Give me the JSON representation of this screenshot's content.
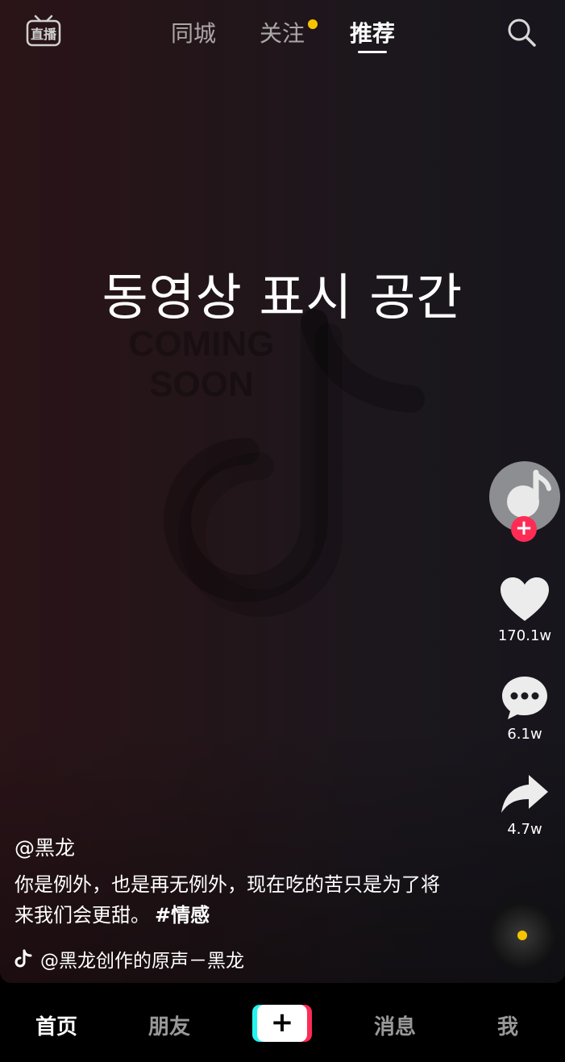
{
  "top_bar": {
    "live_label": "直播",
    "tabs": [
      {
        "label": "同城",
        "active": false,
        "has_dot": false
      },
      {
        "label": "关注",
        "active": false,
        "has_dot": true
      },
      {
        "label": "推荐",
        "active": true,
        "has_dot": false
      }
    ],
    "dot_color": "#f8c400"
  },
  "video": {
    "caption": "동영상 표시 공간",
    "watermark_text_line1": "COMING",
    "watermark_text_line2": "SOON"
  },
  "actions": {
    "follow_label": "+",
    "like_count": "170.1w",
    "comment_count": "6.1w",
    "share_count": "4.7w"
  },
  "post": {
    "author": "@黑龙",
    "description": "你是例外，也是再无例外，现在吃的苦只是为了将来我们会更甜。",
    "hashtag": "#情感",
    "music": "@黑龙创作的原声－黑龙"
  },
  "bottom_nav": {
    "items": [
      {
        "label": "首页",
        "active": true
      },
      {
        "label": "朋友",
        "active": false
      },
      {
        "label": "消息",
        "active": false
      },
      {
        "label": "我",
        "active": false
      }
    ],
    "create_label": "+"
  },
  "colors": {
    "accent_red": "#fe2c55",
    "accent_cyan": "#25f4ee",
    "badge_yellow": "#f8c400"
  }
}
